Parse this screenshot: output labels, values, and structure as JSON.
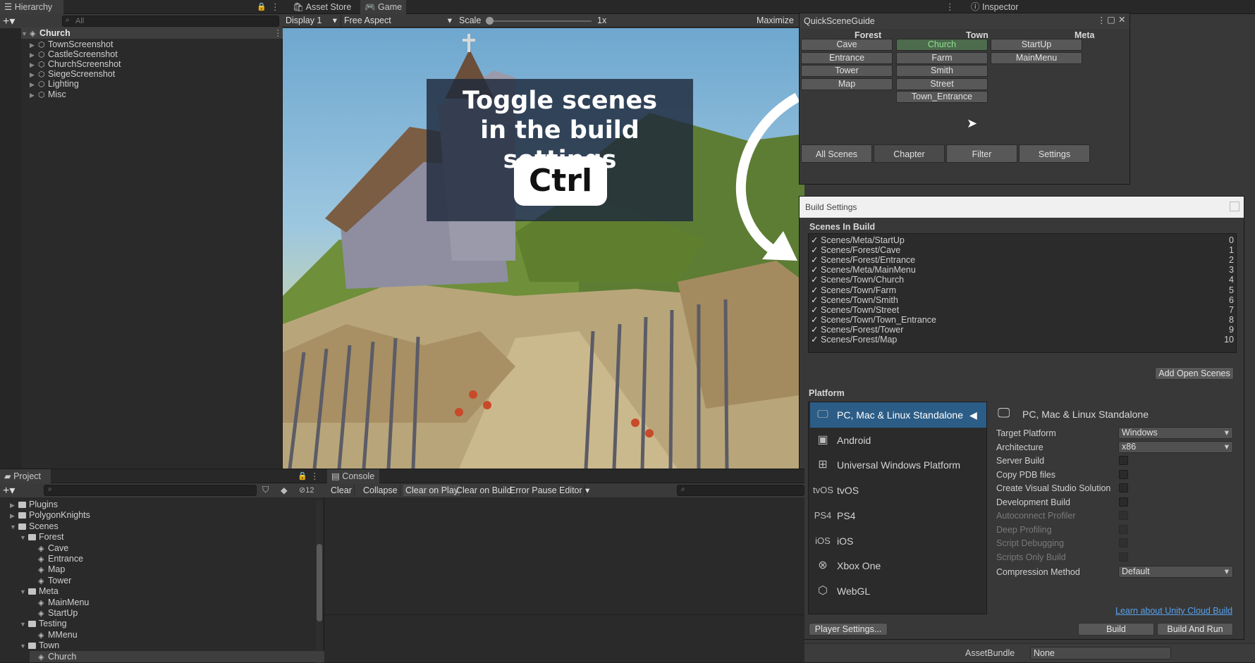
{
  "hierarchy": {
    "tab": "Hierarchy",
    "search_placeholder": "All",
    "root": "Church",
    "items": [
      "TownScreenshot",
      "CastleScreenshot",
      "ChurchScreenshot",
      "SiegeScreenshot",
      "Lighting",
      "Misc"
    ]
  },
  "game_tabs": {
    "asset_store": "Asset Store",
    "game": "Game",
    "inspector": "Inspector"
  },
  "game_toolbar": {
    "display": "Display 1",
    "aspect": "Free Aspect",
    "scale_label": "Scale",
    "scale_value": "1x",
    "maximize": "Maximize"
  },
  "overlay": {
    "line1": "Toggle scenes",
    "line2": "in the build settings",
    "key": "Ctrl"
  },
  "quick": {
    "title": "QuickSceneGuide",
    "columns": [
      "Forest",
      "Town",
      "Meta"
    ],
    "forest": [
      "Cave",
      "Entrance",
      "Tower",
      "Map"
    ],
    "town": [
      "Church",
      "Farm",
      "Smith",
      "Street",
      "Town_Entrance"
    ],
    "meta": [
      "StartUp",
      "MainMenu"
    ],
    "bottom": [
      "All Scenes",
      "Chapter",
      "Filter",
      "Settings"
    ]
  },
  "build": {
    "title": "Build Settings",
    "scenes_header": "Scenes In Build",
    "scenes": [
      {
        "path": "Scenes/Meta/StartUp",
        "idx": "0"
      },
      {
        "path": "Scenes/Forest/Cave",
        "idx": "1"
      },
      {
        "path": "Scenes/Forest/Entrance",
        "idx": "2"
      },
      {
        "path": "Scenes/Meta/MainMenu",
        "idx": "3"
      },
      {
        "path": "Scenes/Town/Church",
        "idx": "4"
      },
      {
        "path": "Scenes/Town/Farm",
        "idx": "5"
      },
      {
        "path": "Scenes/Town/Smith",
        "idx": "6"
      },
      {
        "path": "Scenes/Town/Street",
        "idx": "7"
      },
      {
        "path": "Scenes/Town/Town_Entrance",
        "idx": "8"
      },
      {
        "path": "Scenes/Forest/Tower",
        "idx": "9"
      },
      {
        "path": "Scenes/Forest/Map",
        "idx": "10"
      }
    ],
    "add_open": "Add Open Scenes",
    "platform_header": "Platform",
    "platforms": [
      "PC, Mac & Linux Standalone",
      "Android",
      "Universal Windows Platform",
      "tvOS",
      "PS4",
      "iOS",
      "Xbox One",
      "WebGL"
    ],
    "platform_icons": [
      "monitor-icon",
      "android-icon",
      "windows-icon",
      "tvos-icon",
      "ps4-icon",
      "ios-icon",
      "xbox-icon",
      "html5-icon"
    ],
    "platform_icon_text": [
      "",
      "",
      "",
      "tvOS",
      "PS4",
      "iOS",
      "",
      ""
    ],
    "selected_title": "PC, Mac & Linux Standalone",
    "settings": [
      {
        "label": "Target Platform",
        "value": "Windows"
      },
      {
        "label": "Architecture",
        "value": "x86"
      }
    ],
    "checks": [
      "Server Build",
      "Copy PDB files",
      "Create Visual Studio Solution",
      "Development Build"
    ],
    "disabled_checks": [
      "Autoconnect Profiler",
      "Deep Profiling",
      "Script Debugging",
      "Scripts Only Build"
    ],
    "compression_label": "Compression Method",
    "compression_value": "Default",
    "cloud_link": "Learn about Unity Cloud Build",
    "player_settings": "Player Settings...",
    "build": "Build",
    "build_run": "Build And Run"
  },
  "project": {
    "tab": "Project",
    "hidden_count": "12",
    "tree": [
      {
        "name": "Plugins",
        "depth": 0,
        "type": "folder",
        "open": false
      },
      {
        "name": "PolygonKnights",
        "depth": 0,
        "type": "folder",
        "open": false
      },
      {
        "name": "Scenes",
        "depth": 0,
        "type": "folder",
        "open": true
      },
      {
        "name": "Forest",
        "depth": 1,
        "type": "folder",
        "open": true
      },
      {
        "name": "Cave",
        "depth": 2,
        "type": "scene"
      },
      {
        "name": "Entrance",
        "depth": 2,
        "type": "scene"
      },
      {
        "name": "Map",
        "depth": 2,
        "type": "scene"
      },
      {
        "name": "Tower",
        "depth": 2,
        "type": "scene"
      },
      {
        "name": "Meta",
        "depth": 1,
        "type": "folder",
        "open": true
      },
      {
        "name": "MainMenu",
        "depth": 2,
        "type": "scene"
      },
      {
        "name": "StartUp",
        "depth": 2,
        "type": "scene"
      },
      {
        "name": "Testing",
        "depth": 1,
        "type": "folder",
        "open": true
      },
      {
        "name": "MMenu",
        "depth": 2,
        "type": "scene"
      },
      {
        "name": "Town",
        "depth": 1,
        "type": "folder",
        "open": true
      },
      {
        "name": "Church",
        "depth": 2,
        "type": "scene"
      }
    ]
  },
  "console": {
    "tab": "Console",
    "buttons": [
      "Clear",
      "Collapse",
      "Clear on Play",
      "Clear on Build",
      "Error Pause",
      "Editor"
    ]
  },
  "inspector": {
    "assetbundle_label": "AssetBundle",
    "assetbundle_value": "None"
  }
}
